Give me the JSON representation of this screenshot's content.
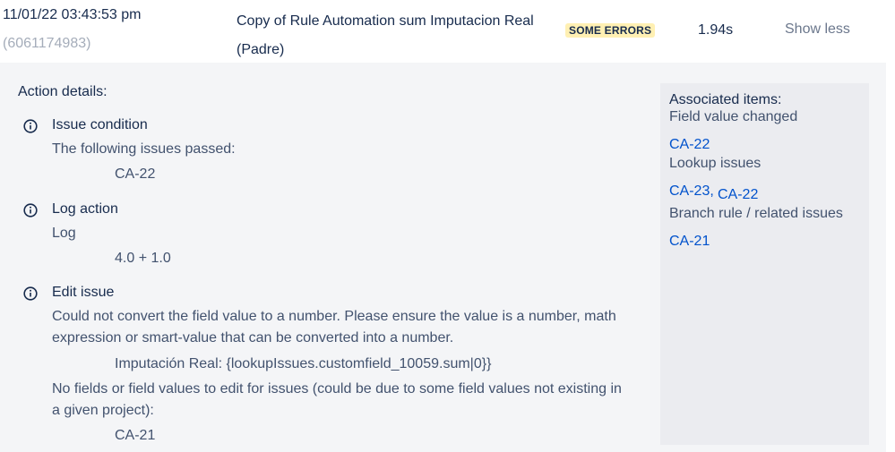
{
  "entry": {
    "date": "11/01/22 03:43:53 pm",
    "execution_id": "(6061174983)",
    "rule_name_line1": "Copy of Rule Automation sum Imputacion Real",
    "rule_name_line2": "(Padre)",
    "status": "SOME ERRORS",
    "duration": "1.94s",
    "toggle_label": "Show less"
  },
  "details": {
    "title": "Action details:",
    "actions": [
      {
        "icon": "info-icon",
        "title": "Issue condition",
        "lines": [
          "The following issues passed:"
        ],
        "values": [
          "CA-22"
        ]
      },
      {
        "icon": "info-icon",
        "title": "Log action",
        "lines": [
          "Log"
        ],
        "values": [
          "4.0 + 1.0"
        ]
      },
      {
        "icon": "info-icon",
        "title": "Edit issue",
        "lines": [
          "Could not convert the field value to a number. Please ensure the value is a number, math",
          "expression or smart-value that can be converted into a number.",
          "No fields or field values to edit for issues (could be due to some field values not existing in",
          "a given project):"
        ],
        "values": [
          "Imputación Real: {lookupIssues.customfield_10059.sum|0}}",
          "CA-21"
        ]
      }
    ]
  },
  "associated": {
    "title": "Associated items:",
    "groups": [
      {
        "label": "Field value changed",
        "links": [
          "CA-22"
        ]
      },
      {
        "label": "Lookup issues",
        "links": [
          "CA-23,",
          "CA-22"
        ]
      },
      {
        "label": "Branch rule / related issues",
        "links": [
          "CA-21"
        ]
      }
    ]
  },
  "colors": {
    "status_badge_bg": "#fff0b3",
    "link": "#0052cc",
    "panel_bg": "#f4f5f7",
    "assoc_bg": "#ebecf0"
  }
}
